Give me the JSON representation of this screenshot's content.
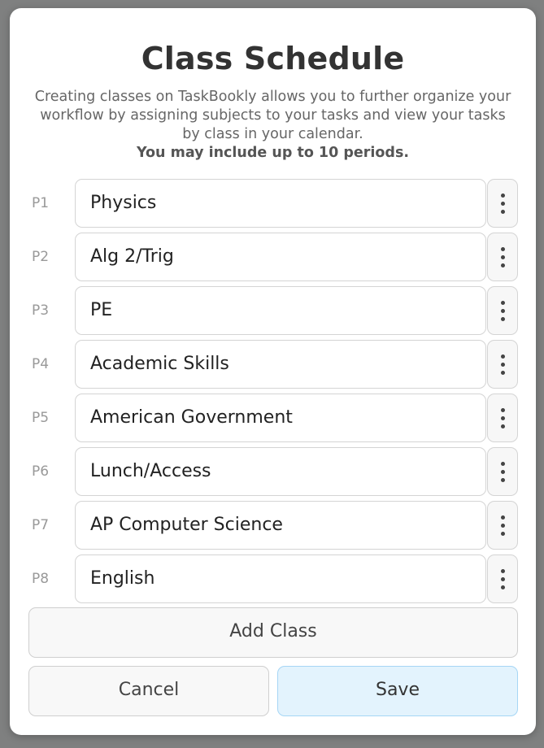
{
  "dialog": {
    "title": "Class Schedule",
    "description": "Creating classes on TaskBookly allows you to further organize your workflow by assigning subjects to your tasks and view your tasks by class in your calendar.",
    "limit_note": "You may include up to 10 periods."
  },
  "periods": [
    {
      "label": "P1",
      "value": "Physics"
    },
    {
      "label": "P2",
      "value": "Alg 2/Trig"
    },
    {
      "label": "P3",
      "value": "PE"
    },
    {
      "label": "P4",
      "value": "Academic Skills"
    },
    {
      "label": "P5",
      "value": "American Government"
    },
    {
      "label": "P6",
      "value": "Lunch/Access"
    },
    {
      "label": "P7",
      "value": "AP Computer Science"
    },
    {
      "label": "P8",
      "value": "English"
    }
  ],
  "period_menu_icon": "vertical-ellipsis-icon",
  "actions": {
    "add_label": "Add Class",
    "cancel_label": "Cancel",
    "save_label": "Save"
  },
  "colors": {
    "save_background": "#e3f3fd",
    "save_border": "#a6d6f5",
    "overlay": "#7f8080"
  }
}
